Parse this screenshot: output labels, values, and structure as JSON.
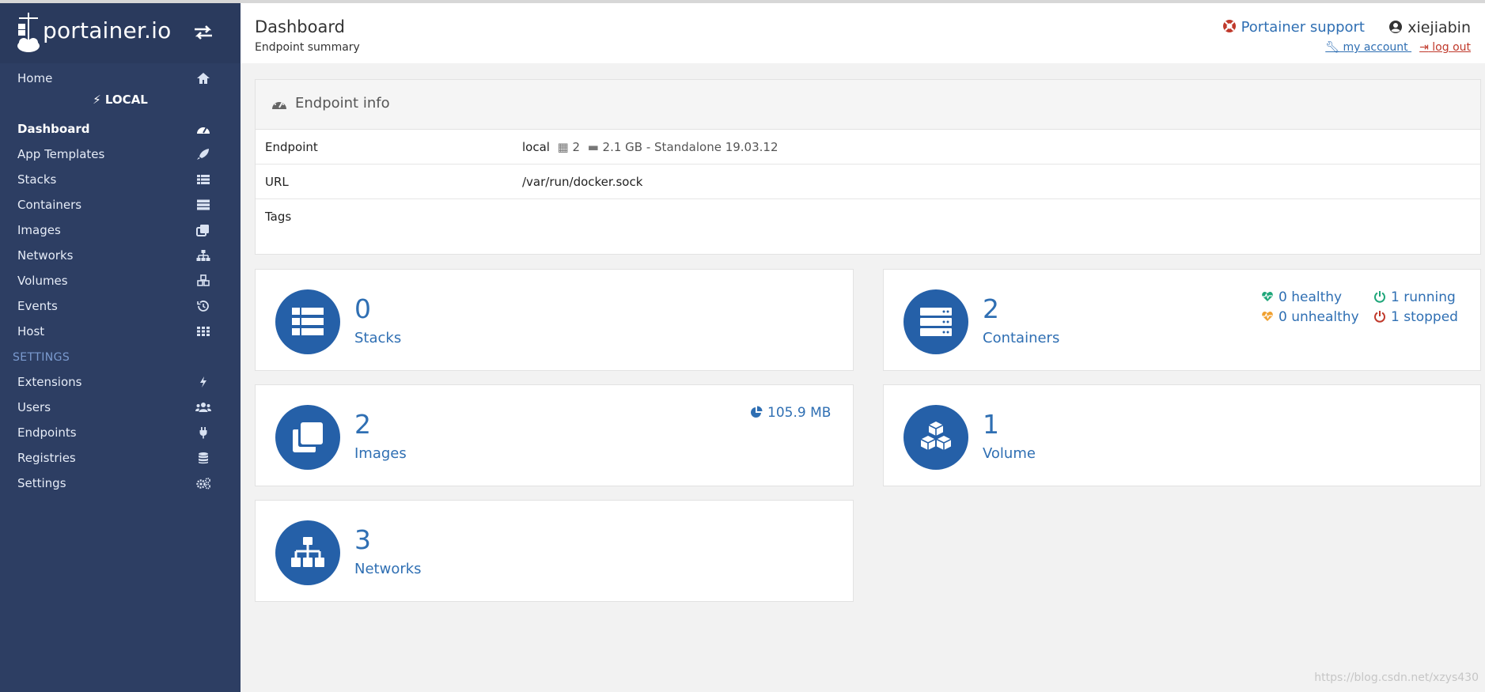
{
  "brand": {
    "logo_text": "portainer.io"
  },
  "sidebar": {
    "home": "Home",
    "endpoint_name": "LOCAL",
    "items": [
      {
        "label": "Dashboard",
        "icon": "tachometer-icon",
        "active": true
      },
      {
        "label": "App Templates",
        "icon": "rocket-icon"
      },
      {
        "label": "Stacks",
        "icon": "list-icon"
      },
      {
        "label": "Containers",
        "icon": "server-icon"
      },
      {
        "label": "Images",
        "icon": "clone-icon"
      },
      {
        "label": "Networks",
        "icon": "sitemap-icon"
      },
      {
        "label": "Volumes",
        "icon": "cubes-icon"
      },
      {
        "label": "Events",
        "icon": "history-icon"
      },
      {
        "label": "Host",
        "icon": "grid-icon"
      }
    ],
    "settings_heading": "SETTINGS",
    "settings_items": [
      {
        "label": "Extensions",
        "icon": "bolt-icon"
      },
      {
        "label": "Users",
        "icon": "users-icon"
      },
      {
        "label": "Endpoints",
        "icon": "plug-icon"
      },
      {
        "label": "Registries",
        "icon": "database-icon"
      },
      {
        "label": "Settings",
        "icon": "cogs-icon"
      }
    ]
  },
  "header": {
    "title": "Dashboard",
    "subtitle": "Endpoint summary",
    "support_label": "Portainer support",
    "username": "xiejiabin",
    "my_account": " my account ",
    "log_out": " log out"
  },
  "endpoint_info": {
    "heading": "Endpoint info",
    "rows": {
      "endpoint": {
        "key": "Endpoint",
        "name": "local",
        "cpus": "2",
        "memory": "2.1 GB",
        "mode": "- Standalone 19.03.12"
      },
      "url": {
        "key": "URL",
        "value": "/var/run/docker.sock"
      },
      "tags": {
        "key": "Tags",
        "value": ""
      }
    }
  },
  "widgets": {
    "stacks": {
      "count": "0",
      "label": "Stacks"
    },
    "containers": {
      "count": "2",
      "label": "Containers",
      "healthy": "0 healthy",
      "unhealthy": "0 unhealthy",
      "running": "1 running",
      "stopped": "1 stopped"
    },
    "images": {
      "count": "2",
      "label": "Images",
      "size": "105.9 MB"
    },
    "volumes": {
      "count": "1",
      "label": "Volume"
    },
    "networks": {
      "count": "3",
      "label": "Networks"
    }
  },
  "colors": {
    "sidebar_bg": "#2d3e63",
    "accent": "#2f6fb3",
    "widget_icon_bg": "#2560a8",
    "healthy": "#1fa67a",
    "unhealthy": "#f0a030",
    "running": "#1fa67a",
    "stopped": "#c0392b"
  },
  "watermark": "https://blog.csdn.net/xzys430"
}
